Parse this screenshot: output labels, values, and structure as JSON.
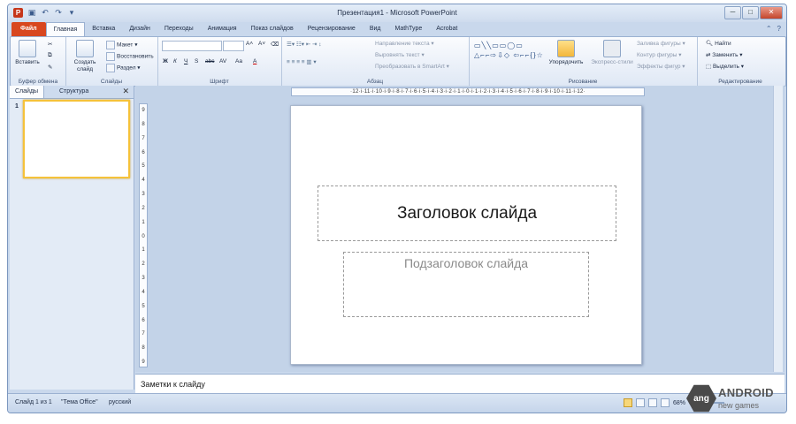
{
  "window": {
    "title": "Презентация1 - Microsoft PowerPoint",
    "app_icon": "P"
  },
  "qat": {
    "icons": [
      "save-icon",
      "undo-icon",
      "redo-icon",
      "customize-icon"
    ],
    "glyphs": [
      "▣",
      "↶",
      "↷",
      "▾"
    ]
  },
  "window_controls": {
    "minimize": "─",
    "maximize": "□",
    "close": "✕"
  },
  "tabs": [
    "Файл",
    "Главная",
    "Вставка",
    "Дизайн",
    "Переходы",
    "Анимация",
    "Показ слайдов",
    "Рецензирование",
    "Вид",
    "MathType",
    "Acrobat"
  ],
  "active_tab": "Главная",
  "ribbon": {
    "clipboard": {
      "paste": "Вставить",
      "label": "Буфер обмена"
    },
    "slides": {
      "new_slide": "Создать слайд",
      "layout": "Макет ▾",
      "reset": "Восстановить",
      "section": "Раздел ▾",
      "label": "Слайды"
    },
    "font": {
      "grow": "A˄",
      "shrink": "A˅",
      "clear": "⌫",
      "bold": "Ж",
      "italic": "К",
      "underline": "Ч",
      "shadow": "S",
      "strike": "abc",
      "spacing": "AV",
      "case": "Aa",
      "color": "A",
      "label": "Шрифт"
    },
    "paragraph": {
      "text_direction": "Направление текста ▾",
      "align_text": "Выровнять текст ▾",
      "smartart": "Преобразовать в SmartArt ▾",
      "label": "Абзац"
    },
    "drawing": {
      "shapes": "▭╲╲▭▭◯▭ △⌐⌐⇨⇩◇ ⇦⌐⌐{}☆",
      "arrange": "Упорядочить",
      "quick_styles": "Экспресс-стили",
      "fill": "Заливка фигуры ▾",
      "outline": "Контур фигуры ▾",
      "effects": "Эффекты фигур ▾",
      "label": "Рисование"
    },
    "editing": {
      "find": "Найти",
      "replace": "Заменить ▾",
      "select": "Выделить ▾",
      "label": "Редактирование"
    }
  },
  "panel": {
    "tabs": [
      "Слайды",
      "Структура"
    ],
    "close": "✕",
    "slide_number": "1"
  },
  "ruler": {
    "horizontal": "·12·i·11·i·10·i·9·i·8·i·7·i·6·i·5·i·4·i·3·i·2·i·1·i·0·i·1·i·2·i·3·i·4·i·5·i·6·i·7·i·8·i·9·i·10·i·11·i·12·",
    "vertical": [
      "9",
      "8",
      "7",
      "6",
      "5",
      "4",
      "3",
      "2",
      "1",
      "0",
      "1",
      "2",
      "3",
      "4",
      "5",
      "6",
      "7",
      "8",
      "9"
    ]
  },
  "slide": {
    "title_placeholder": "Заголовок слайда",
    "subtitle_placeholder": "Подзаголовок слайда"
  },
  "notes": {
    "placeholder": "Заметки к слайду"
  },
  "status": {
    "slide": "Слайд 1 из 1",
    "theme": "\"Тема Office\"",
    "language": "русский",
    "zoom": "68%"
  },
  "watermark": {
    "badge": "ang",
    "line1": "ANDROID",
    "line2": "new games"
  }
}
